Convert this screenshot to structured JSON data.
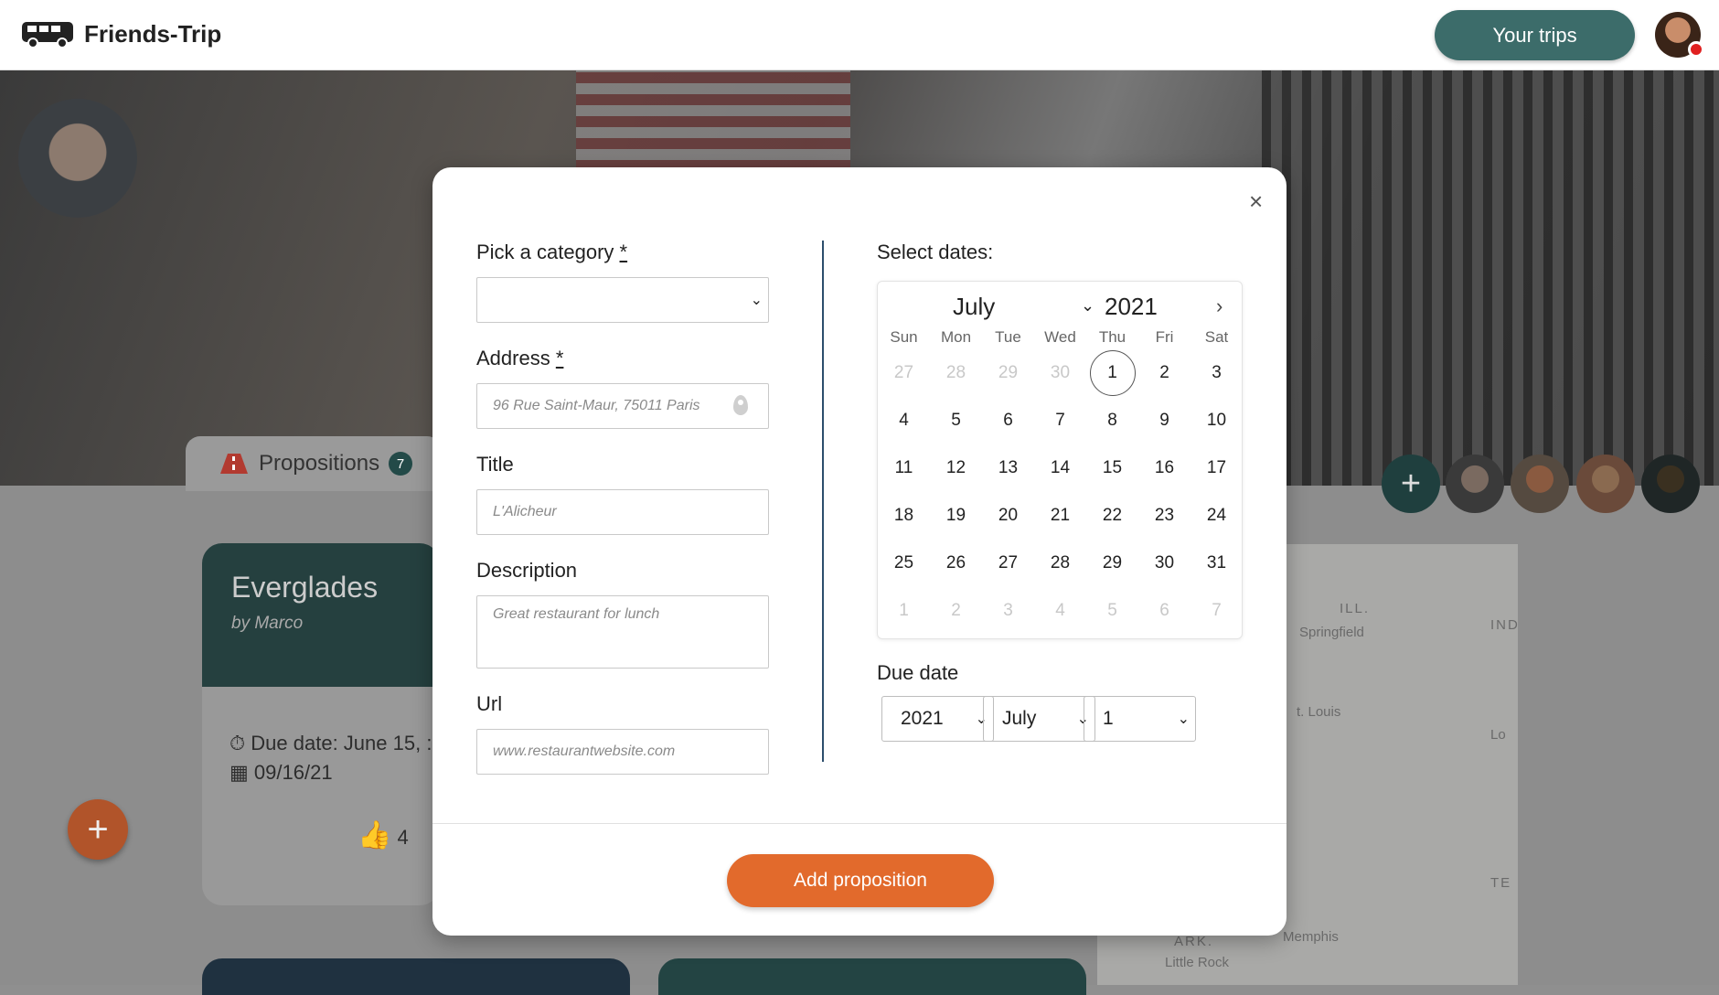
{
  "header": {
    "brand": "Friends-Trip",
    "your_trips": "Your trips"
  },
  "background": {
    "tab_label": "Propositions",
    "tab_count": "7",
    "card": {
      "title": "Everglades",
      "author": "by Marco",
      "due_date": "Due date: June 15, :",
      "date": "09/16/21",
      "likes": "4"
    },
    "map_labels": [
      "ILL.",
      "Springfield",
      "IND",
      "t. Louis",
      "TE",
      "ARK.",
      "Memphis",
      "Little Rock",
      "Lo"
    ]
  },
  "modal": {
    "close": "×",
    "category_label": "Pick a category",
    "category_required": "*",
    "category_value": "",
    "address_label": "Address",
    "address_required": "*",
    "address_placeholder": "96 Rue Saint-Maur, 75011 Paris",
    "title_label": "Title",
    "title_placeholder": "L'Alicheur",
    "description_label": "Description",
    "description_placeholder": "Great restaurant for lunch",
    "url_label": "Url",
    "url_placeholder": "www.restaurantwebsite.com",
    "dates_label": "Select dates:",
    "calendar": {
      "month": "July",
      "year": "2021",
      "weekdays": [
        "Sun",
        "Mon",
        "Tue",
        "Wed",
        "Thu",
        "Fri",
        "Sat"
      ],
      "weeks": [
        [
          {
            "d": "27",
            "m": true
          },
          {
            "d": "28",
            "m": true
          },
          {
            "d": "29",
            "m": true
          },
          {
            "d": "30",
            "m": true
          },
          {
            "d": "1",
            "s": true
          },
          {
            "d": "2"
          },
          {
            "d": "3"
          }
        ],
        [
          {
            "d": "4"
          },
          {
            "d": "5"
          },
          {
            "d": "6"
          },
          {
            "d": "7"
          },
          {
            "d": "8"
          },
          {
            "d": "9"
          },
          {
            "d": "10"
          }
        ],
        [
          {
            "d": "11"
          },
          {
            "d": "12"
          },
          {
            "d": "13"
          },
          {
            "d": "14"
          },
          {
            "d": "15"
          },
          {
            "d": "16"
          },
          {
            "d": "17"
          }
        ],
        [
          {
            "d": "18"
          },
          {
            "d": "19"
          },
          {
            "d": "20"
          },
          {
            "d": "21"
          },
          {
            "d": "22"
          },
          {
            "d": "23"
          },
          {
            "d": "24"
          }
        ],
        [
          {
            "d": "25"
          },
          {
            "d": "26"
          },
          {
            "d": "27"
          },
          {
            "d": "28"
          },
          {
            "d": "29"
          },
          {
            "d": "30"
          },
          {
            "d": "31"
          }
        ],
        [
          {
            "d": "1",
            "m": true
          },
          {
            "d": "2",
            "m": true
          },
          {
            "d": "3",
            "m": true
          },
          {
            "d": "4",
            "m": true
          },
          {
            "d": "5",
            "m": true
          },
          {
            "d": "6",
            "m": true
          },
          {
            "d": "7",
            "m": true
          }
        ]
      ]
    },
    "due_label": "Due date",
    "due_year": "2021",
    "due_month": "July",
    "due_day": "1",
    "submit": "Add proposition"
  },
  "colors": {
    "accent": "#e26a2c",
    "primary": "#3c6c6a"
  }
}
